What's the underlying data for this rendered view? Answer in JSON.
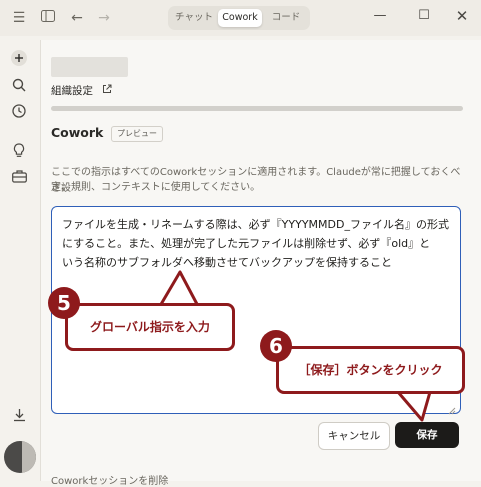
{
  "titlebar": {
    "tabs": [
      "チャット",
      "Cowork",
      "コード"
    ],
    "active_tab": "Cowork"
  },
  "settings": {
    "org_link": "組織設定",
    "section_title": "Cowork",
    "badge": "プレビュー",
    "description_line1": "ここでの指示はすべてのCoworkセッションに適用されます。Claudeが常に把握しておくべき設",
    "description_line2": "定、規則、コンテキストに使用してください。",
    "instruction_lines": [
      "ファイルを生成・リネームする際は、必ず『YYYYMMDD_ファイル名』の形式",
      "にすること。また、処理が完了した元ファイルは削除せず、必ず『old』と",
      "いう名称のサブフォルダへ移動させてバックアップを保持すること"
    ],
    "cancel_label": "キャンセル",
    "save_label": "保存",
    "footer_partial": "Coworkセッションを削除"
  },
  "annotations": {
    "step5_number": "5",
    "step5_label": "グローバル指示を入力",
    "step6_number": "6",
    "step6_label": "［保存］ボタンをクリック",
    "accent_color": "#8e1a1c"
  },
  "colors": {
    "focus_border": "#2f5fb8",
    "primary_button": "#1c1b19"
  }
}
